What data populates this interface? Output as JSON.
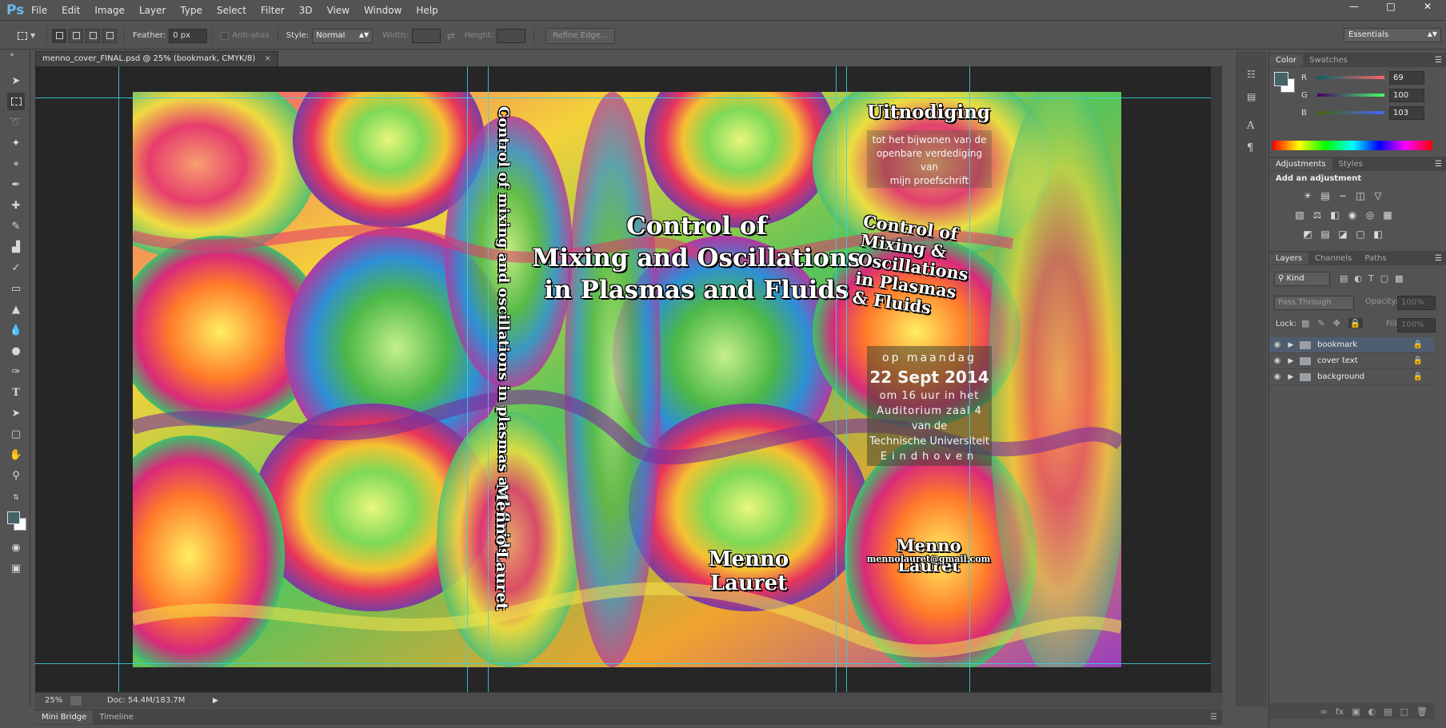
{
  "app": {
    "logo": "Ps",
    "menu": [
      "File",
      "Edit",
      "Image",
      "Layer",
      "Type",
      "Select",
      "Filter",
      "3D",
      "View",
      "Window",
      "Help"
    ],
    "workspace": "Essentials",
    "window_controls": [
      "minimize",
      "maximize",
      "close"
    ]
  },
  "options": {
    "feather_label": "Feather:",
    "feather_value": "0 px",
    "antialias_label": "Anti-alias",
    "style_label": "Style:",
    "style_value": "Normal",
    "width_label": "Width:",
    "height_label": "Height:",
    "refine_edge": "Refine Edge..."
  },
  "document": {
    "tab_title": "menno_cover_FINAL.psd @ 25% (bookmark, CMYK/8)",
    "zoom": "25%",
    "doc_size": "Doc: 54.4M/183.7M"
  },
  "cover": {
    "spine_title": "Control of mixing and oscillations in plasmas and fluids",
    "spine_author": "Menno Lauret",
    "front_title_lines": [
      "Control of",
      "Mixing and Oscillations",
      "in Plasmas and Fluids"
    ],
    "front_author": "Menno Lauret",
    "invite_heading": "Uitnodiging",
    "invite_text": [
      "tot het bijwonen van de",
      "openbare verdediging van",
      "mijn proefschrift"
    ],
    "back_title_lines": [
      "Control of",
      "Mixing &",
      "Oscillations",
      "in Plasmas",
      "& Fluids"
    ],
    "date_lines": [
      "op maandag",
      "22 Sept 2014",
      "om 16 uur in het",
      "Auditorium zaal 4",
      "van de",
      "Technische Universiteit",
      "Eindhoven"
    ],
    "back_author": "Menno Lauret",
    "back_email": "mennolauret@gmail.com"
  },
  "bottom_tabs": [
    "Mini Bridge",
    "Timeline"
  ],
  "color_panel": {
    "tabs": [
      "Color",
      "Swatches"
    ],
    "r_label": "R",
    "r_value": "69",
    "g_label": "G",
    "g_value": "100",
    "b_label": "B",
    "b_value": "103",
    "foreground": "#456467"
  },
  "adjustments_panel": {
    "tabs": [
      "Adjustments",
      "Styles"
    ],
    "heading": "Add an adjustment"
  },
  "layers_panel": {
    "tabs": [
      "Layers",
      "Channels",
      "Paths"
    ],
    "filter_kind": "Kind",
    "blend_mode": "Pass Through",
    "opacity_label": "Opacity:",
    "opacity_value": "100%",
    "lock_label": "Lock:",
    "fill_label": "Fill:",
    "fill_value": "100%",
    "layers": [
      {
        "name": "bookmark",
        "selected": true
      },
      {
        "name": "cover text",
        "selected": false
      },
      {
        "name": "background",
        "selected": false
      }
    ]
  }
}
